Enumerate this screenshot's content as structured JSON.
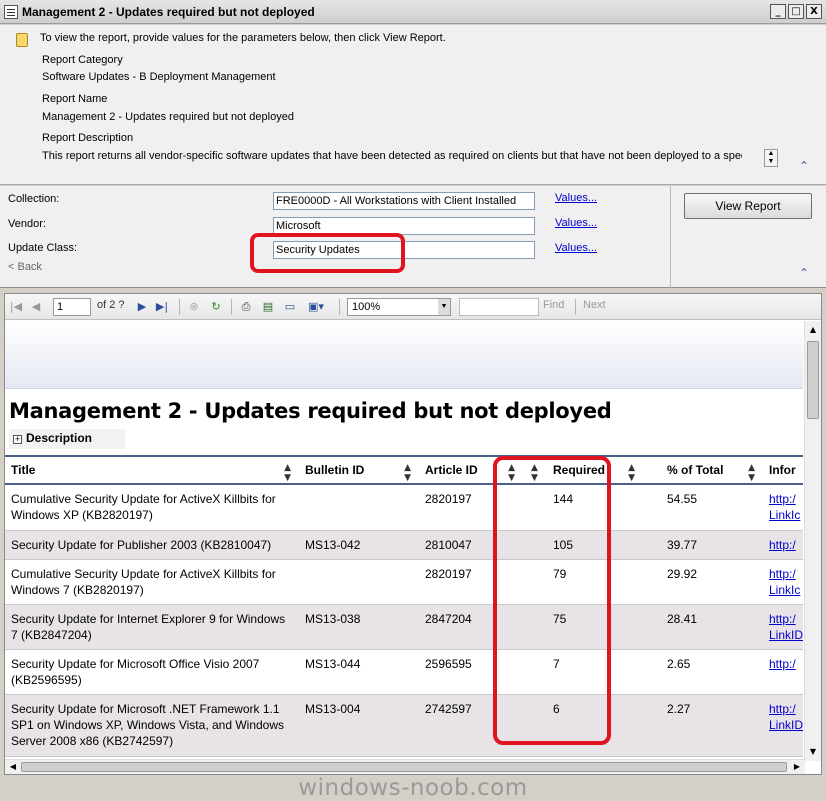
{
  "window": {
    "title": "Management 2 - Updates required but not deployed",
    "buttons": {
      "minimize": "_",
      "maximize": "□",
      "close": "X"
    }
  },
  "info": {
    "note": "To view the report, provide values for the parameters below, then click View Report.",
    "category_label": "Report Category",
    "category_value": "Software Updates - B Deployment Management",
    "name_label": "Report Name",
    "name_value": "Management 2 - Updates required but not deployed",
    "description_label": "Report Description",
    "description_value": "This report returns all vendor-specific software updates that have been detected as required on clients but that have not been deployed to a specific"
  },
  "params": {
    "collection_label": "Collection:",
    "collection_value": "FRE0000D - All Workstations with Client Installed",
    "vendor_label": "Vendor:",
    "vendor_value": "Microsoft",
    "update_class_label": "Update Class:",
    "update_class_value": "Security Updates",
    "values_link": "Values...",
    "back_label": "< Back",
    "view_report_label": "View Report"
  },
  "toolbar": {
    "page": "1",
    "of_pages": "of  2 ?",
    "zoom": "100%",
    "find_label": "Find",
    "next_label": "Next"
  },
  "report": {
    "title": "Management 2 - Updates required but not deployed",
    "description_toggle": "Description",
    "columns": [
      "Title",
      "Bulletin ID",
      "Article ID",
      "Required",
      "% of Total",
      "Infor"
    ],
    "rows": [
      {
        "title": "Cumulative Security Update for ActiveX Killbits for Windows XP (KB2820197)",
        "bulletin": "",
        "article": "2820197",
        "required": "144",
        "percent": "54.55",
        "link1": "http:/",
        "link2": "LinkIc"
      },
      {
        "title": "Security Update for Publisher 2003 (KB2810047)",
        "bulletin": "MS13-042",
        "article": "2810047",
        "required": "105",
        "percent": "39.77",
        "link1": "http:/",
        "link2": ""
      },
      {
        "title": "Cumulative Security Update for ActiveX Killbits for Windows 7 (KB2820197)",
        "bulletin": "",
        "article": "2820197",
        "required": "79",
        "percent": "29.92",
        "link1": "http:/",
        "link2": "LinkIc"
      },
      {
        "title": "Security Update for Internet Explorer 9 for Windows 7 (KB2847204)",
        "bulletin": "MS13-038",
        "article": "2847204",
        "required": "75",
        "percent": "28.41",
        "link1": "http:/",
        "link2": "LinkID"
      },
      {
        "title": "Security Update for Microsoft Office Visio 2007 (KB2596595)",
        "bulletin": "MS13-044",
        "article": "2596595",
        "required": "7",
        "percent": "2.65",
        "link1": "http:/",
        "link2": ""
      },
      {
        "title": "Security Update for Microsoft .NET Framework 1.1 SP1 on Windows XP, Windows Vista, and Windows Server 2008 x86 (KB2742597)",
        "bulletin": "MS13-004",
        "article": "2742597",
        "required": "6",
        "percent": "2.27",
        "link1": "http:/",
        "link2": "LinkID"
      }
    ]
  },
  "watermark": "windows-noob.com",
  "colors": {
    "highlight": "#e0141e",
    "link": "#0000cc",
    "header_rule": "#4a5f8a",
    "alt_row": "#e7e3e7"
  }
}
